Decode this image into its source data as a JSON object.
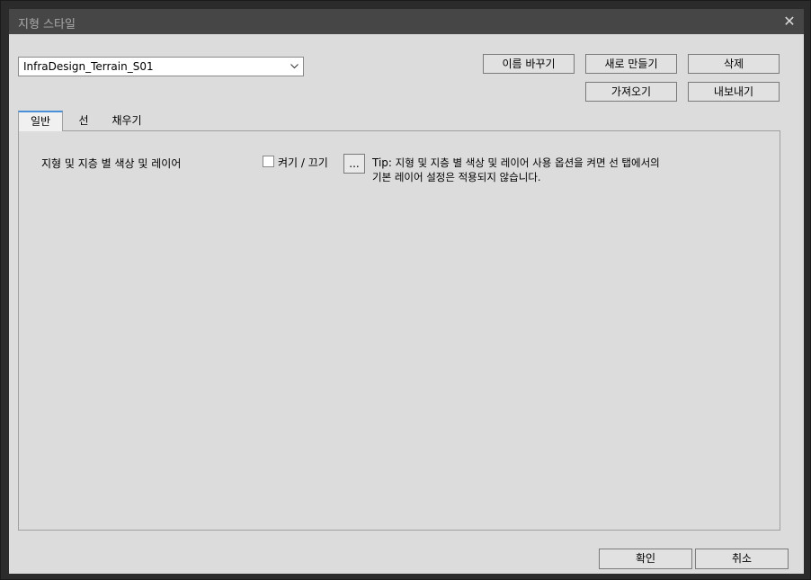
{
  "window": {
    "title": "지형 스타일",
    "close_glyph": "✕"
  },
  "style_select": {
    "value": "InfraDesign_Terrain_S01"
  },
  "buttons": {
    "rename": "이름 바꾸기",
    "new": "새로 만들기",
    "delete": "삭제",
    "import": "가져오기",
    "export": "내보내기",
    "ok": "확인",
    "cancel": "취소"
  },
  "tabs": [
    {
      "label": "일반",
      "active": true
    },
    {
      "label": "선",
      "active": false
    },
    {
      "label": "채우기",
      "active": false
    }
  ],
  "general": {
    "row_label": "지형 및 지층 별 색상 및 레이어",
    "toggle_label": "켜기 / 끄기",
    "toggle_checked": false,
    "ellipsis": "...",
    "tip_prefix": "Tip:",
    "tip_line1": " 지형 및 지층 별 색상 및 레이어 사용 옵션을 켜면 선 탭에서의",
    "tip_line2": "기본 레이어 설정은 적용되지 않습니다."
  }
}
